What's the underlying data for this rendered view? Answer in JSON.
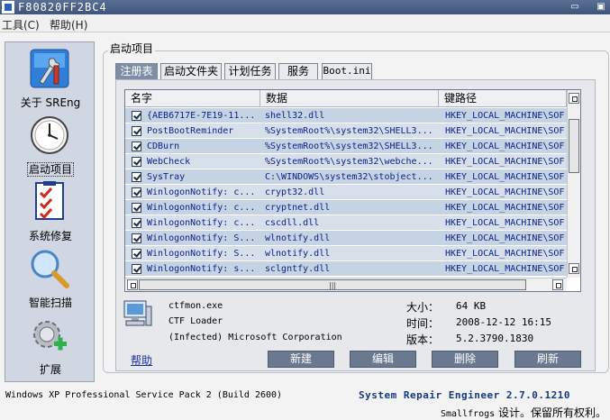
{
  "window": {
    "title": "F80820FF2BC4"
  },
  "menu": {
    "items": [
      "工具(C)",
      "帮助(H)"
    ]
  },
  "sidebar": {
    "items": [
      {
        "label": "关于 SREng",
        "icon": "tools-icon"
      },
      {
        "label": "启动项目",
        "icon": "clock-icon",
        "active": true
      },
      {
        "label": "系统修复",
        "icon": "checklist-icon"
      },
      {
        "label": "智能扫描",
        "icon": "magnifier-icon"
      },
      {
        "label": "扩展",
        "icon": "gear-plus-icon"
      }
    ]
  },
  "group": {
    "title": "启动项目"
  },
  "tabs": [
    "注册表",
    "启动文件夹",
    "计划任务",
    "服务",
    "Boot.ini"
  ],
  "list": {
    "columns": [
      "名字",
      "数据",
      "键路径"
    ],
    "rows": [
      {
        "name": "{AEB6717E-7E19-11...",
        "data": "shell32.dll",
        "key": "HKEY_LOCAL_MACHINE\\SOF"
      },
      {
        "name": "PostBootReminder",
        "data": "%SystemRoot%\\system32\\SHELL3...",
        "key": "HKEY_LOCAL_MACHINE\\SOF"
      },
      {
        "name": "CDBurn",
        "data": "%SystemRoot%\\system32\\SHELL3...",
        "key": "HKEY_LOCAL_MACHINE\\SOF"
      },
      {
        "name": "WebCheck",
        "data": "%SystemRoot%\\system32\\webche...",
        "key": "HKEY_LOCAL_MACHINE\\SOF"
      },
      {
        "name": "SysTray",
        "data": "C:\\WINDOWS\\system32\\stobject...",
        "key": "HKEY_LOCAL_MACHINE\\SOF"
      },
      {
        "name": "WinlogonNotify: c...",
        "data": "crypt32.dll",
        "key": "HKEY_LOCAL_MACHINE\\SOF"
      },
      {
        "name": "WinlogonNotify: c...",
        "data": "cryptnet.dll",
        "key": "HKEY_LOCAL_MACHINE\\SOF"
      },
      {
        "name": "WinlogonNotify: c...",
        "data": "cscdll.dll",
        "key": "HKEY_LOCAL_MACHINE\\SOF"
      },
      {
        "name": "WinlogonNotify: S...",
        "data": "wlnotify.dll",
        "key": "HKEY_LOCAL_MACHINE\\SOF"
      },
      {
        "name": "WinlogonNotify: S...",
        "data": "wlnotify.dll",
        "key": "HKEY_LOCAL_MACHINE\\SOF"
      },
      {
        "name": "WinlogonNotify: s...",
        "data": "sclgntfy.dll",
        "key": "HKEY_LOCAL_MACHINE\\SOF"
      }
    ],
    "hscroll_grip": "|||"
  },
  "details": {
    "file": "ctfmon.exe",
    "description": "CTF Loader",
    "company": "(Infected) Microsoft Corporation",
    "size_label": "大小：",
    "size_value": "64 KB",
    "time_label": "时间：",
    "time_value": "2008-12-12 16:15",
    "version_label": "版本：",
    "version_value": "5.2.3790.1830"
  },
  "actions": {
    "help": "帮助",
    "new": "新建",
    "edit": "编辑",
    "delete": "删除",
    "refresh": "刷新"
  },
  "status": {
    "os": "Windows XP Professional Service Pack 2 (Build 2600)",
    "product": "System Repair Engineer 2.7.0.1210",
    "copyright_brand": "Smallfrogs",
    "copyright_text": " 设计。保留所有权利。"
  },
  "colors": {
    "accent": "#6a7890",
    "tab_active": "#7e8ea6",
    "link": "#1a2ea8",
    "row_text": "#0a1f8c"
  }
}
